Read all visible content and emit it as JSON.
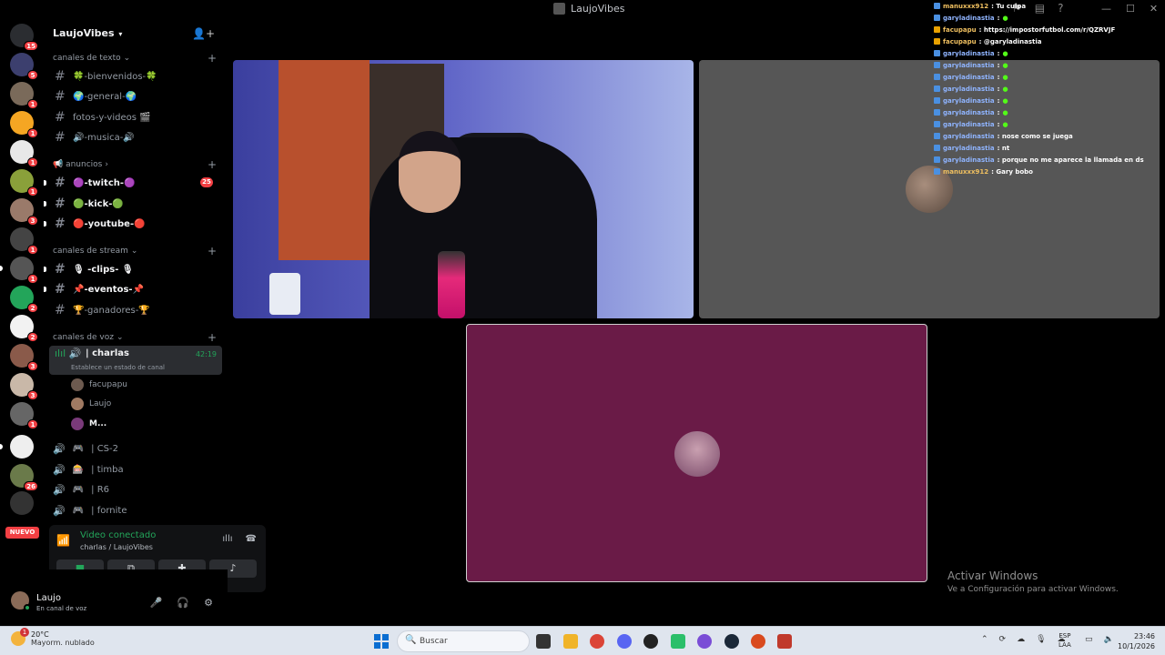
{
  "window": {
    "title": "LaujoVibes",
    "minimize": "—",
    "maximize": "☐",
    "close": "✕"
  },
  "rail": {
    "badges": [
      "15",
      "5",
      "1",
      "1",
      "1",
      "1",
      "3",
      "1",
      "1",
      "2",
      "2",
      "3",
      "3",
      "1",
      "26"
    ],
    "nuevo_label": "NUEVO"
  },
  "sidebar": {
    "server_name": "LaujoVibes",
    "categories": {
      "text": "canales de texto",
      "anuncios": "📢 anuncios",
      "stream": "canales de stream",
      "voice": "canales de voz"
    },
    "text_channels": [
      "🍀-bienvenidos-🍀",
      "🌍-general-🌍",
      "fotos-y-videos 🎬",
      "🔊-musica-🔊"
    ],
    "anuncios_channels": [
      "🟣-twitch-🟣",
      "🟢-kick-🟢",
      "🔴-youtube-🔴"
    ],
    "anuncios_mention": "25",
    "stream_channels": [
      "🎙 -clips- 🎙",
      "📌-eventos-📌",
      "🏆-ganadores-🏆"
    ],
    "voice_active": {
      "name": "| charlas",
      "time": "42:19",
      "status": "Establece un estado de canal"
    },
    "voice_users": [
      "facupapu",
      "Laujo",
      "M..."
    ],
    "voice_channels": [
      "| CS-2",
      "| timba",
      "| R6",
      "| fornite"
    ]
  },
  "voice_panel": {
    "title": "Video conectado",
    "subtitle": "charlas / LaujoVibes"
  },
  "user_panel": {
    "name": "Laujo",
    "status": "En canal de voz"
  },
  "chat": [
    {
      "user": "manuxxx912",
      "msg": ": Tu culpa",
      "platform": "kick"
    },
    {
      "user": "garyladinastia",
      "msg": ":",
      "emote": true,
      "platform": "kick"
    },
    {
      "user": "facupapu",
      "msg": ": https://impostorfutbol.com/r/QZRVJF",
      "platform": "twitch"
    },
    {
      "user": "facupapu",
      "msg": ": @garyladinastia",
      "platform": "twitch"
    },
    {
      "user": "garyladinastia",
      "msg": ":",
      "emote": true,
      "platform": "kick"
    },
    {
      "user": "garyladinastia",
      "msg": ":",
      "emote": true,
      "platform": "kick"
    },
    {
      "user": "garyladinastia",
      "msg": ":",
      "emote": true,
      "platform": "kick"
    },
    {
      "user": "garyladinastia",
      "msg": ":",
      "emote": true,
      "platform": "kick"
    },
    {
      "user": "garyladinastia",
      "msg": ":",
      "emote": true,
      "platform": "kick"
    },
    {
      "user": "garyladinastia",
      "msg": ":",
      "emote": true,
      "platform": "kick"
    },
    {
      "user": "garyladinastia",
      "msg": ":",
      "emote": true,
      "platform": "kick"
    },
    {
      "user": "garyladinastia",
      "msg": ": nose como se juega",
      "platform": "kick"
    },
    {
      "user": "garyladinastia",
      "msg": ": nt",
      "platform": "kick"
    },
    {
      "user": "garyladinastia",
      "msg": ": porque no me aparece la llamada en ds",
      "platform": "kick"
    },
    {
      "user": "manuxxx912",
      "msg": ": Gary bobo",
      "platform": "kick"
    }
  ],
  "activate_windows": {
    "line1": "Activar Windows",
    "line2": "Ve a Configuración para activar Windows."
  },
  "taskbar": {
    "temp": "20°C",
    "weather": "Mayorm. nublado",
    "weather_badge": "1",
    "search_placeholder": "Buscar",
    "lang1": "ESP",
    "lang2": "LAA",
    "time": "23:46",
    "date": "10/1/2026"
  },
  "colors": {
    "accent_green": "#23a55a",
    "mention_red": "#f23f43",
    "tile_magenta": "#6a1b47"
  }
}
